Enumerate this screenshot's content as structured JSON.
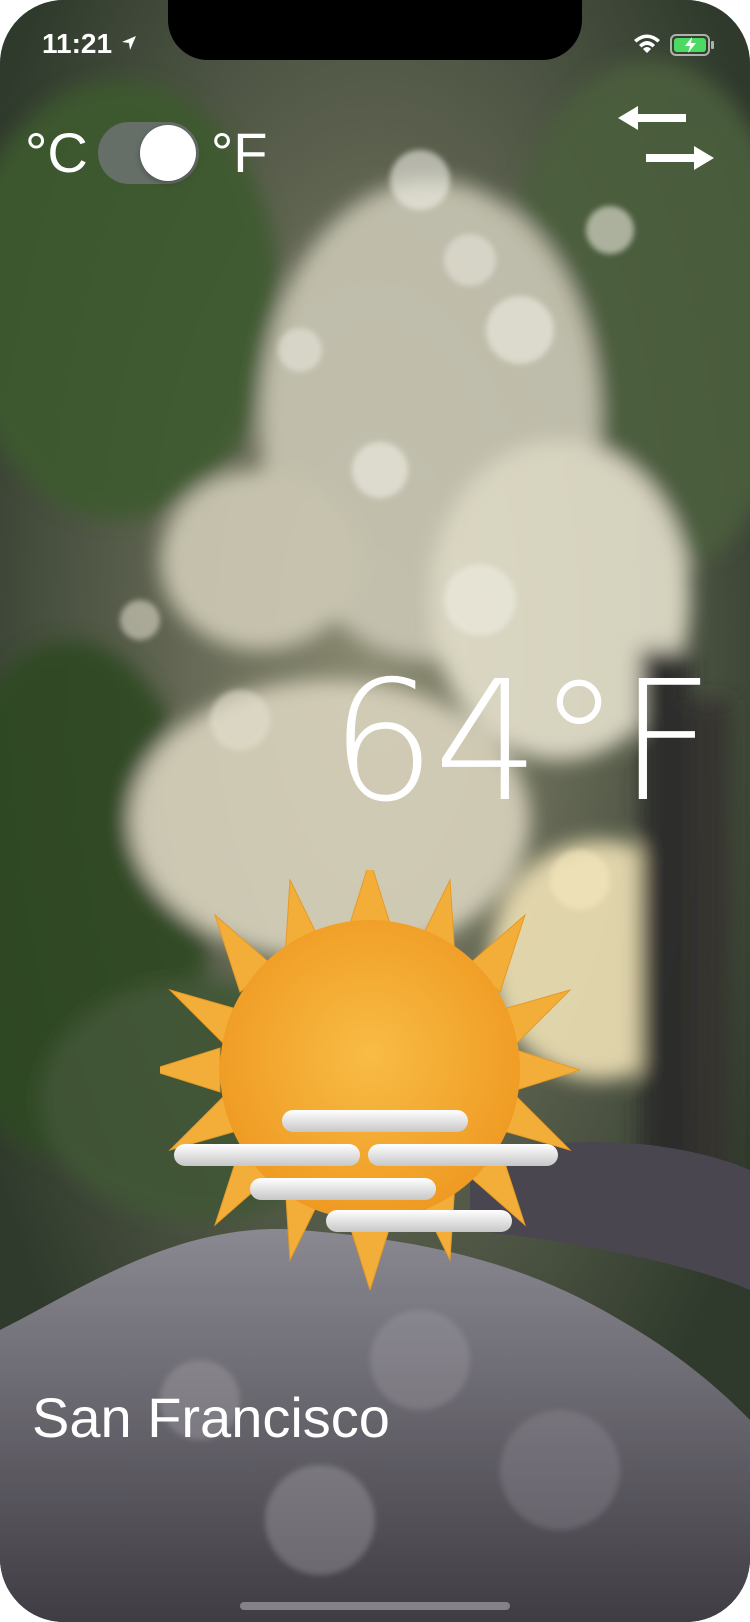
{
  "status_bar": {
    "time": "11:21"
  },
  "units": {
    "celsius_label": "°C",
    "fahrenheit_label": "°F"
  },
  "weather": {
    "temperature": "64°F",
    "condition_icon": "sun-fog-icon"
  },
  "location": {
    "city": "San Francisco"
  },
  "icons": {
    "swap": "swap-arrows-icon",
    "location": "location-arrow-icon",
    "wifi": "wifi-icon",
    "battery": "battery-charging-icon"
  },
  "colors": {
    "sun": "#f5a623",
    "sun_ray": "#f3ae3a",
    "battery": "#4cd964"
  }
}
